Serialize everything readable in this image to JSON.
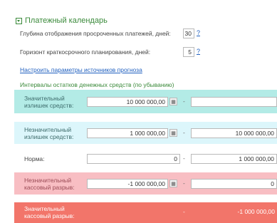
{
  "group": {
    "title": "Платежный календарь",
    "overdue_depth_label": "Глубина отображения просроченных платежей, дней:",
    "overdue_depth_value": "30",
    "planning_horizon_label": "Горизонт краткосрочного планирования, дней:",
    "planning_horizon_value": "5",
    "help_label": "?",
    "configure_link": "Настроить параметры источников прогноза",
    "intervals_label": "Интервалы остатков денежных средств (по убыванию)"
  },
  "intervals": [
    {
      "label": "Значительный излишек средств:",
      "from": "10 000 000,00",
      "to": "",
      "color": "#b3ebe6"
    },
    {
      "label": "Незначительный излишек средств:",
      "from": "1 000 000,00",
      "to": "10 000 000,00",
      "color": "#dcf6fb"
    },
    {
      "label": "Норма:",
      "from": "0",
      "to": "1 000 000,00",
      "color": "#ffffff"
    },
    {
      "label": "Незначительный кассовый разрыв:",
      "from": "-1 000 000,00",
      "to": "0",
      "color": "#f8bec3"
    },
    {
      "label": "Значительный кассовый разрыв:",
      "from": "",
      "to": "-1 000 000,00",
      "color": "#f2756a"
    }
  ],
  "dash": "-",
  "calendar_icon": "calendar-icon"
}
